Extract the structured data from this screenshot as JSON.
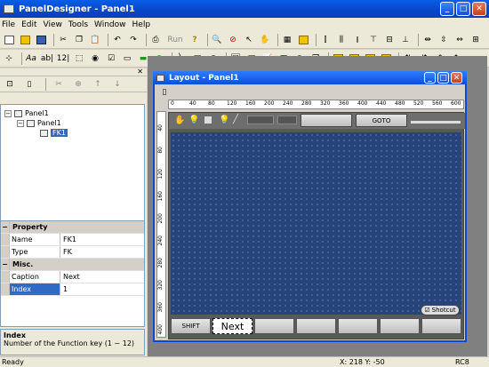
{
  "window": {
    "title": "PanelDesigner - Panel1"
  },
  "menu": [
    "File",
    "Edit",
    "View",
    "Tools",
    "Window",
    "Help"
  ],
  "toolbar1": {
    "run_label": "Run"
  },
  "toolbar2": {
    "text_a": "Aa",
    "text_ab": "ab|",
    "text_12": "12|"
  },
  "tree": {
    "root": "Panel1",
    "child": "Panel1",
    "leaf": "FK1"
  },
  "properties": {
    "header": "Property",
    "rows": [
      {
        "name": "Name",
        "value": "FK1"
      },
      {
        "name": "Type",
        "value": "FK"
      }
    ],
    "misc_header": "Misc.",
    "misc_rows": [
      {
        "name": "Caption",
        "value": "Next"
      },
      {
        "name": "Index",
        "value": "1"
      }
    ]
  },
  "help": {
    "title": "Index",
    "text": "Number of the Function key (1 ~ 12)"
  },
  "layout": {
    "title": "Layout - Panel1",
    "ruler_top": [
      "0",
      "40",
      "80",
      "120",
      "160",
      "200",
      "240",
      "280",
      "320",
      "360",
      "400",
      "440",
      "480",
      "520",
      "560",
      "600"
    ],
    "ruler_left": [
      "40",
      "80",
      "120",
      "160",
      "200",
      "240",
      "280",
      "320",
      "360",
      "400"
    ],
    "goto_label": "GOTO",
    "shotcut_label": "Shotcut",
    "fk_keys": [
      "SHIFT",
      "Next",
      "",
      "",
      "",
      "",
      ""
    ]
  },
  "status": {
    "ready": "Ready",
    "coords": "X:  218  Y:  -50",
    "rc": "RC8"
  },
  "colors": {
    "title_blue": "#0a5ee8",
    "grid": "#27447a",
    "selection": "#316ac5"
  }
}
